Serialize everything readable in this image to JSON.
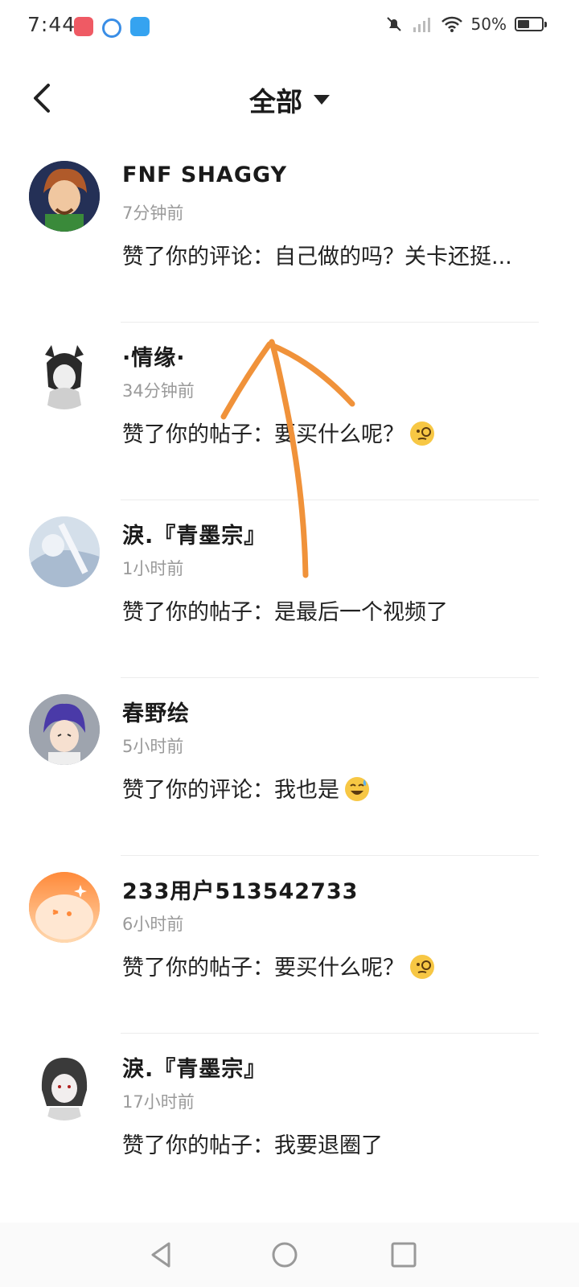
{
  "status_bar": {
    "time": "7:44",
    "battery": "50%"
  },
  "header": {
    "title": "全部"
  },
  "notifications": [
    {
      "name": "FNF SHAGGY",
      "time": "7分钟前",
      "message": "赞了你的评论：自己做的吗？关卡还挺..."
    },
    {
      "name": "·情缘·",
      "time": "34分钟前",
      "message": "赞了你的帖子：要买什么呢？"
    },
    {
      "name": "淚.『青墨宗』",
      "time": "1小时前",
      "message": "赞了你的帖子：是最后一个视频了"
    },
    {
      "name": "春野绘",
      "time": "5小时前",
      "message": "赞了你的评论：我也是"
    },
    {
      "name": "233用户513542733",
      "time": "6小时前",
      "message": "赞了你的帖子：要买什么呢？"
    },
    {
      "name": "淚.『青墨宗』",
      "time": "17小时前",
      "message": "赞了你的帖子：我要退圈了"
    }
  ],
  "colors": {
    "annotation_arrow": "#f0923a",
    "avatar_orange": "#ff9a4a"
  },
  "icons": [
    "back-arrow-icon",
    "dropdown-caret-icon",
    "monocle-face-emoji",
    "grinning-sweat-emoji",
    "nav-back-icon",
    "nav-home-icon",
    "nav-recents-icon"
  ]
}
